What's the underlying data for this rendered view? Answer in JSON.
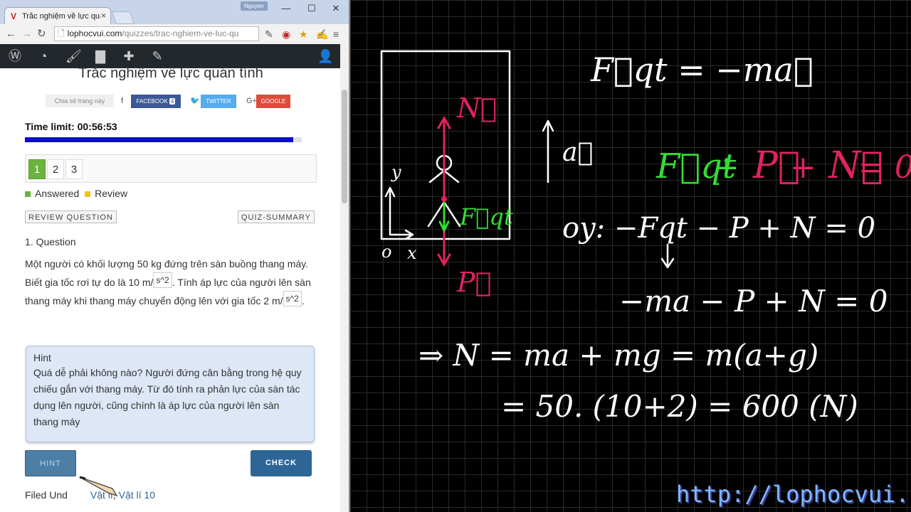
{
  "browser": {
    "tab_title": "Trắc nghiệm về lực quán t",
    "tab_close": "×",
    "user_badge": "Nguyen",
    "url_domain": "lophocvui.com",
    "url_path": "/quizzes/trac-nghiem-ve-luc-qu"
  },
  "page": {
    "title": "Trắc nghiệm về lực quán tính",
    "share": {
      "label": "Chia sẻ trang này",
      "facebook": "FACEBOOK",
      "facebook_count": "4",
      "twitter": "TWITTER",
      "google": "GOOGLE"
    },
    "timer": "Time limit: 00:56:53",
    "progress": 0.97,
    "pages": [
      "1",
      "2",
      "3"
    ],
    "legend": {
      "answered": "Answered",
      "review": "Review"
    },
    "review_question": "REVIEW QUESTION",
    "quiz_summary": "QUIZ-SUMMARY",
    "question": {
      "heading": "1. Question",
      "part1": "Một người có khối lượng 50 kg đứng trên sàn buồng thang máy. Biết gia tốc rơi tự do là 10 m/",
      "img1": "s^2",
      "part2": ". Tính áp lực của người lên sàn thang máy khi thang máy chuyển động lên với gia tốc 2 m/",
      "img2": "s^2",
      "part3": "."
    },
    "hint": {
      "title": "Hint",
      "text": "Quá dễ phải không nào? Người đứng cân bằng trong hệ quy chiếu gắn với thang máy. Từ đó tính ra phản lực của sàn tác dụng lên người, cũng chính là áp lực của người lên sàn thang máy"
    },
    "hint_button": "HINT",
    "check_button": "CHECK",
    "filed_under": "Filed Und",
    "filed_cat1": "Vật lí",
    "filed_sep": ", ",
    "filed_cat2": "Vật lí 10"
  },
  "board": {
    "eq1": "F⃗qt = −ma⃗",
    "a_label": "a⃗",
    "eq2_f": "F⃗qt",
    "eq2_plus1": "+",
    "eq2_p": "P⃗",
    "eq2_plus2": "+",
    "eq2_n": "N⃗",
    "eq2_eq": "= 0⃗",
    "eq3": "oy:  −Fqt − P  +  N = 0",
    "eq4": "−ma − P  + N = 0",
    "eq5": "⇒ N =  ma + mg  = m(a+g)",
    "eq6": "= 50. (10+2)   = 600 (N)",
    "diag_N": "N⃗",
    "diag_F": "F⃗qt",
    "diag_P": "P⃗",
    "axis_y": "y",
    "axis_o": "o",
    "axis_x": "x",
    "watermark": "http://lophocvui.com",
    "colors": {
      "red": "#e0245e",
      "green": "#33dd33",
      "white": "#ffffff"
    }
  }
}
